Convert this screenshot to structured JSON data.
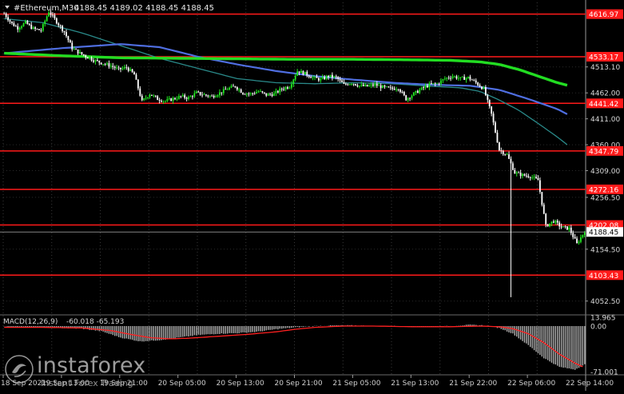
{
  "header": {
    "symbol": "#Ethereum,M30",
    "ohlc": "4188.45 4189.02 4188.45 4188.45"
  },
  "colors": {
    "background": "#000000",
    "candle_up": "#22ee22",
    "candle_down": "#ffffff",
    "ma_fast": "#2a8a8a",
    "ma_mid": "#4f6ee0",
    "ma_slow": "#22dd22",
    "level_line": "#ff1a1a",
    "price_line": "#aaaaaa",
    "macd_hist": "#b0b0b0",
    "macd_signal": "#ff2020"
  },
  "chart_data": [
    {
      "type": "candlestick",
      "name": "#Ethereum,M30",
      "ylim": [
        4030,
        4640
      ],
      "y_ticks": [
        4513.1,
        4462.0,
        4411.0,
        4360.0,
        4309.0,
        4256.5,
        4154.5,
        4052.5
      ],
      "x_tick_labels": [
        "18 Sep 2021",
        "19 Sep 13:00",
        "19 Sep 21:00",
        "20 Sep 05:00",
        "20 Sep 13:00",
        "20 Sep 21:00",
        "21 Sep 05:00",
        "21 Sep 13:00",
        "21 Sep 22:00",
        "22 Sep 06:00",
        "22 Sep 14:00"
      ],
      "resistance_support_levels": [
        4616.97,
        4533.17,
        4441.42,
        4347.79,
        4272.16,
        4202.08,
        4103.43
      ],
      "current_price": 4188.45,
      "price_path": [
        [
          0,
          4618
        ],
        [
          4,
          4598
        ],
        [
          7,
          4590
        ],
        [
          11,
          4600
        ],
        [
          15,
          4588
        ],
        [
          19,
          4585
        ],
        [
          23,
          4622
        ],
        [
          27,
          4602
        ],
        [
          31,
          4582
        ],
        [
          35,
          4550
        ],
        [
          39,
          4540
        ],
        [
          43,
          4532
        ],
        [
          47,
          4525
        ],
        [
          51,
          4520
        ],
        [
          55,
          4515
        ],
        [
          59,
          4508
        ],
        [
          63,
          4512
        ],
        [
          67,
          4498
        ],
        [
          71,
          4445
        ],
        [
          75,
          4460
        ],
        [
          79,
          4450
        ],
        [
          83,
          4446
        ],
        [
          87,
          4450
        ],
        [
          91,
          4455
        ],
        [
          95,
          4452
        ],
        [
          99,
          4462
        ],
        [
          103,
          4458
        ],
        [
          107,
          4455
        ],
        [
          111,
          4462
        ],
        [
          115,
          4470
        ],
        [
          119,
          4475
        ],
        [
          123,
          4462
        ],
        [
          127,
          4460
        ],
        [
          131,
          4465
        ],
        [
          135,
          4458
        ],
        [
          139,
          4460
        ],
        [
          143,
          4470
        ],
        [
          147,
          4475
        ],
        [
          151,
          4505
        ],
        [
          155,
          4500
        ],
        [
          159,
          4492
        ],
        [
          163,
          4488
        ],
        [
          167,
          4495
        ],
        [
          171,
          4492
        ],
        [
          175,
          4478
        ],
        [
          179,
          4482
        ],
        [
          183,
          4476
        ],
        [
          187,
          4475
        ],
        [
          191,
          4478
        ],
        [
          195,
          4473
        ],
        [
          199,
          4470
        ],
        [
          203,
          4472
        ],
        [
          207,
          4450
        ],
        [
          211,
          4460
        ],
        [
          215,
          4470
        ],
        [
          219,
          4478
        ],
        [
          223,
          4480
        ],
        [
          227,
          4490
        ],
        [
          231,
          4495
        ],
        [
          235,
          4490
        ],
        [
          239,
          4492
        ],
        [
          243,
          4482
        ],
        [
          247,
          4470
        ],
        [
          251,
          4420
        ],
        [
          255,
          4350
        ],
        [
          259,
          4340
        ],
        [
          263,
          4305
        ],
        [
          267,
          4300
        ],
        [
          271,
          4298
        ],
        [
          275,
          4290
        ],
        [
          279,
          4200
        ],
        [
          283,
          4210
        ],
        [
          287,
          4198
        ],
        [
          291,
          4195
        ],
        [
          295,
          4165
        ],
        [
          299,
          4190
        ]
      ],
      "moving_averages": [
        {
          "color_key": "ma_fast",
          "points": [
            [
              0,
              4608
            ],
            [
              20,
              4600
            ],
            [
              40,
              4580
            ],
            [
              60,
              4555
            ],
            [
              80,
              4530
            ],
            [
              100,
              4510
            ],
            [
              120,
              4490
            ],
            [
              140,
              4482
            ],
            [
              160,
              4480
            ],
            [
              180,
              4482
            ],
            [
              200,
              4480
            ],
            [
              220,
              4475
            ],
            [
              235,
              4472
            ],
            [
              245,
              4465
            ],
            [
              255,
              4448
            ],
            [
              265,
              4428
            ],
            [
              275,
              4402
            ],
            [
              285,
              4375
            ],
            [
              290,
              4360
            ]
          ]
        },
        {
          "color_key": "ma_mid",
          "points": [
            [
              0,
              4540
            ],
            [
              30,
              4550
            ],
            [
              60,
              4558
            ],
            [
              80,
              4552
            ],
            [
              100,
              4533
            ],
            [
              120,
              4518
            ],
            [
              140,
              4505
            ],
            [
              160,
              4495
            ],
            [
              180,
              4488
            ],
            [
              200,
              4482
            ],
            [
              220,
              4478
            ],
            [
              240,
              4476
            ],
            [
              255,
              4468
            ],
            [
              270,
              4450
            ],
            [
              285,
              4430
            ],
            [
              290,
              4420
            ]
          ]
        },
        {
          "color_key": "ma_slow",
          "points": [
            [
              0,
              4540
            ],
            [
              30,
              4535
            ],
            [
              60,
              4531
            ],
            [
              90,
              4530
            ],
            [
              120,
              4529
            ],
            [
              150,
              4528
            ],
            [
              180,
              4528
            ],
            [
              210,
              4527
            ],
            [
              230,
              4526
            ],
            [
              245,
              4523
            ],
            [
              255,
              4518
            ],
            [
              265,
              4508
            ],
            [
              275,
              4495
            ],
            [
              285,
              4482
            ],
            [
              290,
              4477
            ]
          ]
        }
      ]
    },
    {
      "type": "bar",
      "name": "MACD(12,26,9)",
      "header_values": "-60.018 -65.193",
      "ylim": [
        -75,
        15
      ],
      "y_ticks": [
        13.965,
        0.0,
        -71.001
      ],
      "histogram_path": [
        [
          0,
          -1
        ],
        [
          20,
          -2
        ],
        [
          40,
          -4
        ],
        [
          50,
          -8
        ],
        [
          60,
          -18
        ],
        [
          70,
          -24
        ],
        [
          80,
          -22
        ],
        [
          90,
          -18
        ],
        [
          100,
          -14
        ],
        [
          110,
          -12
        ],
        [
          120,
          -11
        ],
        [
          130,
          -9
        ],
        [
          140,
          -5
        ],
        [
          150,
          -2
        ],
        [
          160,
          0
        ],
        [
          170,
          1
        ],
        [
          180,
          1
        ],
        [
          190,
          0
        ],
        [
          200,
          0
        ],
        [
          210,
          -1
        ],
        [
          220,
          -1
        ],
        [
          230,
          0
        ],
        [
          240,
          2
        ],
        [
          248,
          1
        ],
        [
          255,
          -3
        ],
        [
          262,
          -12
        ],
        [
          270,
          -30
        ],
        [
          278,
          -50
        ],
        [
          286,
          -64
        ],
        [
          294,
          -68
        ],
        [
          299,
          -60
        ]
      ],
      "signal_path": [
        [
          0,
          -2
        ],
        [
          20,
          -2
        ],
        [
          40,
          -3
        ],
        [
          55,
          -7
        ],
        [
          65,
          -13
        ],
        [
          75,
          -18
        ],
        [
          85,
          -20
        ],
        [
          95,
          -19
        ],
        [
          110,
          -16
        ],
        [
          125,
          -13
        ],
        [
          140,
          -9
        ],
        [
          150,
          -5
        ],
        [
          160,
          -2
        ],
        [
          175,
          0
        ],
        [
          190,
          0
        ],
        [
          210,
          -1
        ],
        [
          230,
          -1
        ],
        [
          245,
          0
        ],
        [
          255,
          -1
        ],
        [
          262,
          -4
        ],
        [
          270,
          -12
        ],
        [
          278,
          -26
        ],
        [
          286,
          -44
        ],
        [
          294,
          -58
        ],
        [
          299,
          -65
        ]
      ]
    }
  ],
  "watermark": {
    "brand": "instaforex",
    "tagline": "Instant Forex Trading"
  }
}
